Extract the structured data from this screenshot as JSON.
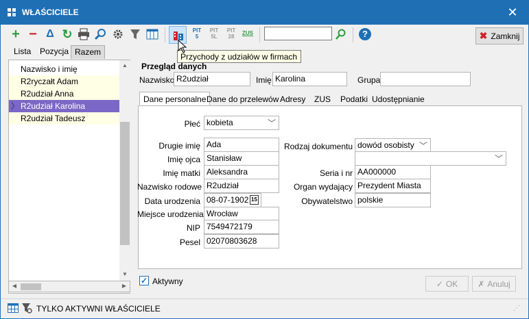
{
  "window": {
    "title": "WŁAŚCICIELE",
    "close_glyph": "✕"
  },
  "toolbar": {
    "add_icon": "+",
    "remove_icon": "−",
    "delta_icon": "Δ",
    "refresh_icon": "↻",
    "print_icon": "printer-icon",
    "search_icon": "magnifier-icon",
    "settings_icon": "gear-icon",
    "filter_icon": "filter-icon",
    "columns_icon": "columns-icon",
    "firms_icon": "firms-icon",
    "pit5_label": "PIT\n5",
    "pit5l_label": "PIT\n5L",
    "pit28_label": "PIT\n28",
    "zus_label": "ZUS",
    "search_value": "",
    "help_icon": "?",
    "close_button_label": "Zamknij",
    "tooltip": "Przychody z udziałów w firmach"
  },
  "left_tabs": [
    "Lista",
    "Pozycja",
    "Razem"
  ],
  "list": {
    "header": "Nazwisko i imię",
    "rows": [
      "R2ryczałt Adam",
      "R2udział Anna",
      "R2udział Karolina",
      "R2udział Tadeusz"
    ],
    "selected_index": 2
  },
  "overview": {
    "section_title": "Przegląd danych",
    "nazwisko_label": "Nazwisko",
    "nazwisko_value": "R2udział",
    "imie_label": "Imię",
    "imie_value": "Karolina",
    "grupa_label": "Grupa",
    "grupa_value": ""
  },
  "tabs": [
    "Dane personalne",
    "Dane do przelewów",
    "Adresy",
    "ZUS",
    "Podatki",
    "Udostępnianie"
  ],
  "personal": {
    "plec_label": "Płeć",
    "plec_value": "kobieta",
    "drugie_imie_label": "Drugie imię",
    "drugie_imie_value": "Ada",
    "imie_ojca_label": "Imię ojca",
    "imie_ojca_value": "Stanisław",
    "imie_matki_label": "Imię matki",
    "imie_matki_value": "Aleksandra",
    "nazwisko_rodowe_label": "Nazwisko rodowe",
    "nazwisko_rodowe_value": "R2udział",
    "data_urodzenia_label": "Data urodzenia",
    "data_urodzenia_value": "08-07-1902",
    "calendar_icon_text": "15",
    "miejsce_urodzenia_label": "Miejsce urodzenia",
    "miejsce_urodzenia_value": "Wrocław",
    "nip_label": "NIP",
    "nip_value": "7549472179",
    "pesel_label": "Pesel",
    "pesel_value": "02070803628",
    "rodzaj_dokumentu_label": "Rodzaj dokumentu",
    "rodzaj_dokumentu_value": "dowód osobisty",
    "rodzaj_extra_value": "",
    "seria_label": "Seria i nr",
    "seria_value": "AA000000",
    "organ_label": "Organ wydający",
    "organ_value": "Prezydent Miasta",
    "obywatelstwo_label": "Obywatelstwo",
    "obywatelstwo_value": "polskie"
  },
  "footer": {
    "aktywny_label": "Aktywny",
    "aktywny_checked": true,
    "ok_label": "OK",
    "anuluj_label": "Anuluj"
  },
  "status": {
    "text": "TYLKO AKTYWNI WŁAŚCICIELE"
  },
  "colors": {
    "accent": "#1f6fb5",
    "selected_row": "#7b68c6",
    "add_green": "#2e9e3e",
    "remove_red": "#d0202c"
  }
}
